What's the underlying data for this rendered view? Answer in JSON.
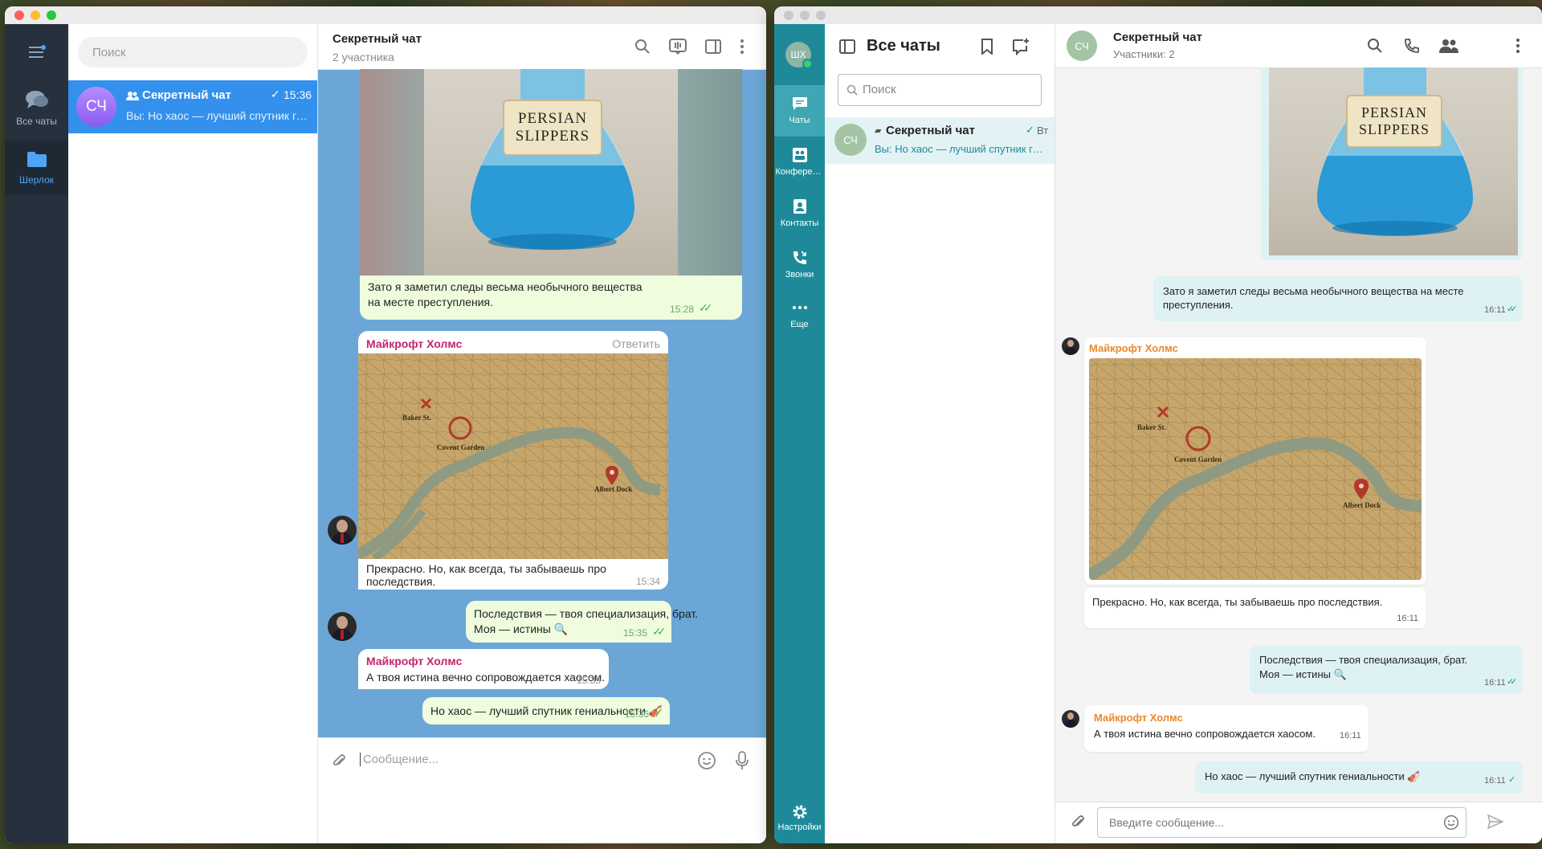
{
  "tg": {
    "folders": [
      {
        "label": "Все чаты",
        "icon": "chat-bubbles-icon"
      },
      {
        "label": "Шерлок",
        "icon": "folder-icon"
      }
    ],
    "search_placeholder": "Поиск",
    "chat_item": {
      "avatar": "СЧ",
      "name": "Секретный чат",
      "time": "15:36",
      "preview": "Вы: Но хаос — лучший спутник гениальности 🎻"
    },
    "header": {
      "title": "Секретный чат",
      "subtitle": "2 участника"
    },
    "messages": {
      "m1": {
        "flask_label_1": "PERSIAN",
        "flask_label_2": "SLIPPERS",
        "text": "Зато я заметил следы весьма необычного вещества на месте преступления.",
        "time": "15:28"
      },
      "m2": {
        "sender": "Майкрофт Холмс",
        "reply": "Ответить",
        "text": "Прекрасно. Но, как всегда, ты забываешь про последствия.",
        "time": "15:34",
        "map_labels": {
          "baker": "Baker St.",
          "covent": "Covent Garden",
          "albert": "Albert Dock"
        }
      },
      "m3": {
        "text1": "Последствия — твоя специализация, брат.",
        "text2": "Моя — истины 🔍",
        "time": "15:35"
      },
      "m4": {
        "sender": "Майкрофт Холмс",
        "text": "А твоя истина вечно сопровождается хаосом.",
        "time": "15:35"
      },
      "m5": {
        "text": "Но хаос — лучший спутник гениальности 🎻",
        "time": "15:36"
      }
    },
    "composer_placeholder": "Сообщение..."
  },
  "mx": {
    "account_avatar": "ШХ",
    "nav": [
      {
        "label": "Чаты",
        "icon": "chat-icon"
      },
      {
        "label": "Конференции",
        "icon": "conference-icon"
      },
      {
        "label": "Контакты",
        "icon": "contacts-icon"
      },
      {
        "label": "Звонки",
        "icon": "calls-icon"
      },
      {
        "label": "Еще",
        "icon": "more-icon"
      },
      {
        "label": "Настройки",
        "icon": "settings-icon"
      }
    ],
    "list_title": "Все чаты",
    "search_placeholder": "Поиск",
    "chat_item": {
      "avatar": "СЧ",
      "name": "Секретный чат",
      "time": "Вт",
      "preview": "Вы: Но хаос — лучший спутник гениальности 🎻"
    },
    "header": {
      "avatar": "СЧ",
      "title": "Секретный чат",
      "subtitle": "Участники: 2"
    },
    "messages": {
      "m1": {
        "flask_label_1": "PERSIAN",
        "flask_label_2": "SLIPPERS",
        "text": "Зато я заметил следы весьма необычного вещества на месте преступления.",
        "time": "16:11"
      },
      "m2": {
        "sender": "Майкрофт Холмс",
        "text": "Прекрасно. Но, как всегда, ты забываешь про последствия.",
        "time": "16:11",
        "map_labels": {
          "baker": "Baker St.",
          "covent": "Covent Garden",
          "albert": "Albert Dock"
        }
      },
      "m3": {
        "text1": "Последствия — твоя специализация, брат.",
        "text2": "Моя — истины 🔍",
        "time": "16:11"
      },
      "m4": {
        "sender": "Майкрофт Холмс",
        "text": "А твоя истина вечно сопровождается хаосом.",
        "time": "16:11"
      },
      "m5": {
        "text": "Но хаос — лучший спутник гениальности 🎻",
        "time": "16:11"
      }
    },
    "composer_placeholder": "Введите сообщение..."
  },
  "colors": {
    "tg_accent": "#3390ec",
    "tg_chat_bg": "#6ba6d6",
    "mx_teal": "#1e8a99",
    "mx_sender": "#e8892c",
    "tg_sender": "#c4246a"
  }
}
